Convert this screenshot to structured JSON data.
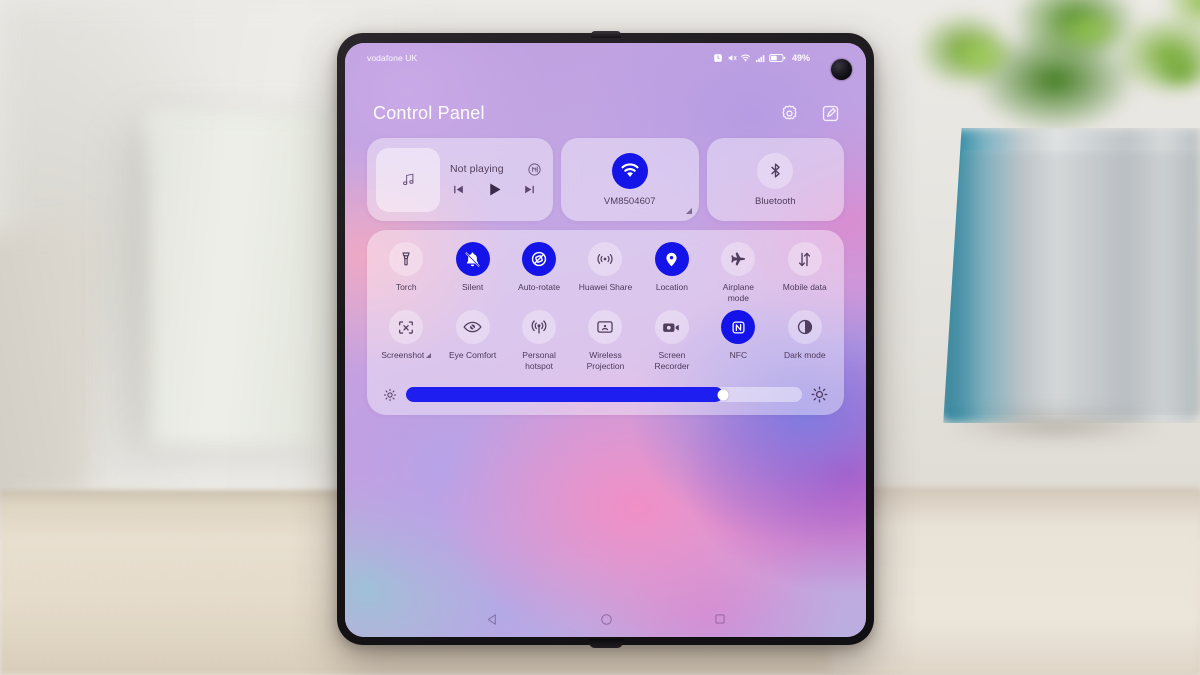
{
  "device": {
    "description": "foldable-phone-unfolded",
    "screen": {
      "wallpaper": "abstract-pink-purple-blue-gradient"
    }
  },
  "statusbar": {
    "carrier": "vodafone UK",
    "battery_percent": "49%",
    "icons": [
      "alarm-icon",
      "mute-icon",
      "wifi-icon",
      "signal-icon",
      "battery-icon"
    ]
  },
  "header": {
    "title": "Control Panel",
    "settings_icon": "gear-icon",
    "edit_icon": "edit-square-icon"
  },
  "media_card": {
    "album_icon": "music-note-icon",
    "status": "Not playing",
    "cast_icon": "audio-output-icon",
    "controls": {
      "previous": "previous-track-icon",
      "play": "play-icon",
      "next": "next-track-icon"
    }
  },
  "connectivity_tiles": [
    {
      "name": "wifi",
      "icon": "wifi-icon",
      "label": "VM8504607",
      "active": true,
      "expandable": true
    },
    {
      "name": "bluetooth",
      "icon": "bluetooth-icon",
      "label": "Bluetooth",
      "active": false,
      "expandable": false
    }
  ],
  "toggles": [
    {
      "name": "torch",
      "icon": "flashlight-icon",
      "label": "Torch",
      "active": false
    },
    {
      "name": "silent",
      "icon": "bell-off-icon",
      "label": "Silent",
      "active": true
    },
    {
      "name": "auto-rotate",
      "icon": "rotate-lock-icon",
      "label": "Auto-rotate",
      "active": true
    },
    {
      "name": "huawei-share",
      "icon": "share-waves-icon",
      "label": "Huawei Share",
      "active": false
    },
    {
      "name": "location",
      "icon": "location-pin-icon",
      "label": "Location",
      "active": true
    },
    {
      "name": "airplane-mode",
      "icon": "airplane-icon",
      "label": "Airplane mode",
      "active": false
    },
    {
      "name": "mobile-data",
      "icon": "data-arrows-icon",
      "label": "Mobile data",
      "active": false
    },
    {
      "name": "screenshot",
      "icon": "screenshot-icon",
      "label": "Screenshot",
      "active": false,
      "expandable": true
    },
    {
      "name": "eye-comfort",
      "icon": "eye-icon",
      "label": "Eye Comfort",
      "active": false
    },
    {
      "name": "personal-hotspot",
      "icon": "hotspot-icon",
      "label": "Personal hotspot",
      "active": false
    },
    {
      "name": "wireless-projection",
      "icon": "cast-screen-icon",
      "label": "Wireless Projection",
      "active": false
    },
    {
      "name": "screen-recorder",
      "icon": "video-camera-icon",
      "label": "Screen Recorder",
      "active": false
    },
    {
      "name": "nfc",
      "icon": "nfc-icon",
      "label": "NFC",
      "active": true
    },
    {
      "name": "dark-mode",
      "icon": "contrast-icon",
      "label": "Dark mode",
      "active": false
    }
  ],
  "brightness": {
    "value_percent": 80,
    "low_icon": "brightness-low-icon",
    "high_icon": "brightness-high-icon"
  },
  "navbar": [
    {
      "name": "back",
      "icon": "back-triangle-icon"
    },
    {
      "name": "home",
      "icon": "home-circle-icon"
    },
    {
      "name": "recents",
      "icon": "recents-square-icon"
    }
  ],
  "colors": {
    "accent_blue": "#1414e8",
    "panel_white": "rgba(255,255,255,0.40)",
    "label_text": "#4e3a5b"
  }
}
